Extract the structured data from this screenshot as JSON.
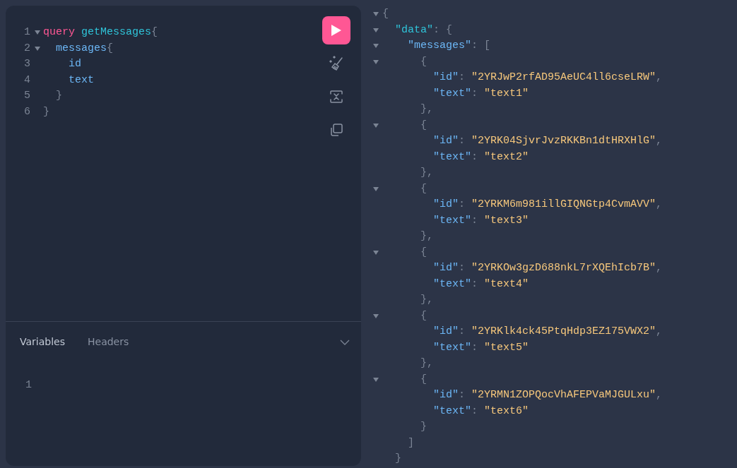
{
  "editor": {
    "lines": [
      {
        "number": "1",
        "foldable": true,
        "expanded": true,
        "tokens": [
          {
            "kind": "keyword",
            "text": "query"
          },
          {
            "kind": "name",
            "text": " getMessages"
          },
          {
            "kind": "punct",
            "text": "{"
          }
        ]
      },
      {
        "number": "2",
        "foldable": true,
        "expanded": true,
        "tokens": [
          {
            "kind": "field",
            "text": "  messages"
          },
          {
            "kind": "punct",
            "text": "{"
          }
        ]
      },
      {
        "number": "3",
        "foldable": false,
        "tokens": [
          {
            "kind": "field",
            "text": "    id"
          }
        ]
      },
      {
        "number": "4",
        "foldable": false,
        "tokens": [
          {
            "kind": "field",
            "text": "    text"
          }
        ]
      },
      {
        "number": "5",
        "foldable": false,
        "tokens": [
          {
            "kind": "punct",
            "text": "  }"
          }
        ]
      },
      {
        "number": "6",
        "foldable": false,
        "tokens": [
          {
            "kind": "punct",
            "text": "}"
          }
        ]
      }
    ]
  },
  "toolbar": [
    {
      "kind": "run"
    },
    {
      "kind": "prettify"
    },
    {
      "kind": "merge"
    },
    {
      "kind": "copy"
    }
  ],
  "bottom_tabs": [
    {
      "label": "Variables",
      "selected": true
    },
    {
      "label": "Headers",
      "selected": false
    }
  ],
  "variables": {
    "lines": [
      {
        "number": "1"
      }
    ]
  },
  "response": {
    "lines": [
      {
        "foldable": true,
        "expanded": true,
        "tokens": [
          {
            "kind": "punct",
            "text": "{"
          }
        ]
      },
      {
        "foldable": true,
        "expanded": true,
        "tokens": [
          {
            "kind": "key",
            "text": "  \"data\""
          },
          {
            "kind": "punct",
            "text": ": {"
          }
        ]
      },
      {
        "foldable": true,
        "expanded": true,
        "tokens": [
          {
            "kind": "key2",
            "text": "    \"messages\""
          },
          {
            "kind": "punct",
            "text": ": ["
          }
        ]
      },
      {
        "foldable": true,
        "expanded": true,
        "tokens": [
          {
            "kind": "punct",
            "text": "      {"
          }
        ]
      },
      {
        "foldable": false,
        "tokens": [
          {
            "kind": "key2",
            "text": "        \"id\""
          },
          {
            "kind": "punct",
            "text": ": "
          },
          {
            "kind": "string",
            "text": "\"2YRJwP2rfAD95AeUC4ll6cseLRW\""
          },
          {
            "kind": "punct",
            "text": ","
          }
        ]
      },
      {
        "foldable": false,
        "tokens": [
          {
            "kind": "key2",
            "text": "        \"text\""
          },
          {
            "kind": "punct",
            "text": ": "
          },
          {
            "kind": "string",
            "text": "\"text1\""
          }
        ]
      },
      {
        "foldable": false,
        "tokens": [
          {
            "kind": "punct",
            "text": "      },"
          }
        ]
      },
      {
        "foldable": true,
        "expanded": true,
        "tokens": [
          {
            "kind": "punct",
            "text": "      {"
          }
        ]
      },
      {
        "foldable": false,
        "tokens": [
          {
            "kind": "key2",
            "text": "        \"id\""
          },
          {
            "kind": "punct",
            "text": ": "
          },
          {
            "kind": "string",
            "text": "\"2YRK04SjvrJvzRKKBn1dtHRXHlG\""
          },
          {
            "kind": "punct",
            "text": ","
          }
        ]
      },
      {
        "foldable": false,
        "tokens": [
          {
            "kind": "key2",
            "text": "        \"text\""
          },
          {
            "kind": "punct",
            "text": ": "
          },
          {
            "kind": "string",
            "text": "\"text2\""
          }
        ]
      },
      {
        "foldable": false,
        "tokens": [
          {
            "kind": "punct",
            "text": "      },"
          }
        ]
      },
      {
        "foldable": true,
        "expanded": true,
        "tokens": [
          {
            "kind": "punct",
            "text": "      {"
          }
        ]
      },
      {
        "foldable": false,
        "tokens": [
          {
            "kind": "key2",
            "text": "        \"id\""
          },
          {
            "kind": "punct",
            "text": ": "
          },
          {
            "kind": "string",
            "text": "\"2YRKM6m981illGIQNGtp4CvmAVV\""
          },
          {
            "kind": "punct",
            "text": ","
          }
        ]
      },
      {
        "foldable": false,
        "tokens": [
          {
            "kind": "key2",
            "text": "        \"text\""
          },
          {
            "kind": "punct",
            "text": ": "
          },
          {
            "kind": "string",
            "text": "\"text3\""
          }
        ]
      },
      {
        "foldable": false,
        "tokens": [
          {
            "kind": "punct",
            "text": "      },"
          }
        ]
      },
      {
        "foldable": true,
        "expanded": true,
        "tokens": [
          {
            "kind": "punct",
            "text": "      {"
          }
        ]
      },
      {
        "foldable": false,
        "tokens": [
          {
            "kind": "key2",
            "text": "        \"id\""
          },
          {
            "kind": "punct",
            "text": ": "
          },
          {
            "kind": "string",
            "text": "\"2YRKOw3gzD688nkL7rXQEhIcb7B\""
          },
          {
            "kind": "punct",
            "text": ","
          }
        ]
      },
      {
        "foldable": false,
        "tokens": [
          {
            "kind": "key2",
            "text": "        \"text\""
          },
          {
            "kind": "punct",
            "text": ": "
          },
          {
            "kind": "string",
            "text": "\"text4\""
          }
        ]
      },
      {
        "foldable": false,
        "tokens": [
          {
            "kind": "punct",
            "text": "      },"
          }
        ]
      },
      {
        "foldable": true,
        "expanded": true,
        "tokens": [
          {
            "kind": "punct",
            "text": "      {"
          }
        ]
      },
      {
        "foldable": false,
        "tokens": [
          {
            "kind": "key2",
            "text": "        \"id\""
          },
          {
            "kind": "punct",
            "text": ": "
          },
          {
            "kind": "string",
            "text": "\"2YRKlk4ck45PtqHdp3EZ175VWX2\""
          },
          {
            "kind": "punct",
            "text": ","
          }
        ]
      },
      {
        "foldable": false,
        "tokens": [
          {
            "kind": "key2",
            "text": "        \"text\""
          },
          {
            "kind": "punct",
            "text": ": "
          },
          {
            "kind": "string",
            "text": "\"text5\""
          }
        ]
      },
      {
        "foldable": false,
        "tokens": [
          {
            "kind": "punct",
            "text": "      },"
          }
        ]
      },
      {
        "foldable": true,
        "expanded": true,
        "tokens": [
          {
            "kind": "punct",
            "text": "      {"
          }
        ]
      },
      {
        "foldable": false,
        "tokens": [
          {
            "kind": "key2",
            "text": "        \"id\""
          },
          {
            "kind": "punct",
            "text": ": "
          },
          {
            "kind": "string",
            "text": "\"2YRMN1ZOPQocVhAFEPVaMJGULxu\""
          },
          {
            "kind": "punct",
            "text": ","
          }
        ]
      },
      {
        "foldable": false,
        "tokens": [
          {
            "kind": "key2",
            "text": "        \"text\""
          },
          {
            "kind": "punct",
            "text": ": "
          },
          {
            "kind": "string",
            "text": "\"text6\""
          }
        ]
      },
      {
        "foldable": false,
        "tokens": [
          {
            "kind": "punct",
            "text": "      }"
          }
        ]
      },
      {
        "foldable": false,
        "tokens": [
          {
            "kind": "punct",
            "text": "    ]"
          }
        ]
      },
      {
        "foldable": false,
        "tokens": [
          {
            "kind": "punct",
            "text": "  }"
          }
        ]
      }
    ]
  }
}
